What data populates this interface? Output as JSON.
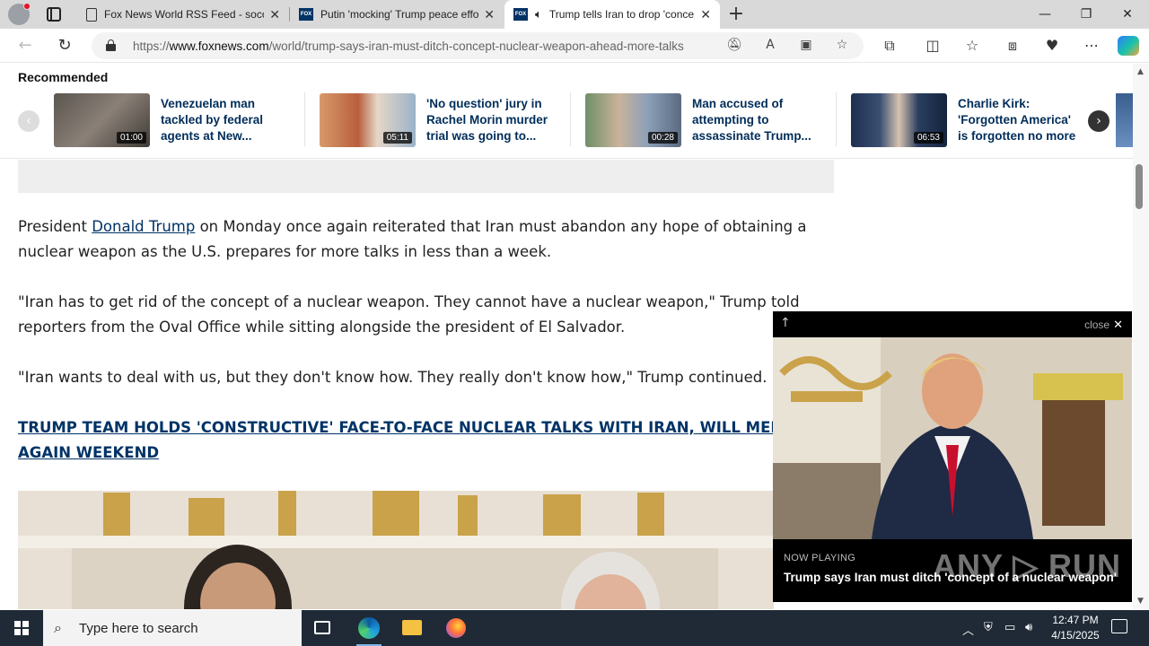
{
  "browser": {
    "tabs": [
      {
        "label": "Fox News World RSS Feed - soccer",
        "icon": "document-icon",
        "active": false
      },
      {
        "label": "Putin 'mocking' Trump peace effort",
        "icon": "foxnews-icon",
        "active": false
      },
      {
        "label": "Trump tells Iran to drop 'concept'",
        "icon": "foxnews-icon",
        "active": true,
        "audio": true
      }
    ],
    "url_prefix": "https://",
    "url_host": "www.foxnews.com",
    "url_path": "/world/trump-says-iran-must-ditch-concept-nuclear-weapon-ahead-more-talks"
  },
  "recommended": {
    "title": "Recommended",
    "items": [
      {
        "title": "Venezuelan man tackled by federal agents at New...",
        "duration": "01:00"
      },
      {
        "title": "'No question' jury in Rachel Morin murder trial was going to...",
        "duration": "05:11"
      },
      {
        "title": "Man accused of attempting to assassinate Trump...",
        "duration": "00:28"
      },
      {
        "title": "Charlie Kirk: 'Forgotten America' is forgotten no more",
        "duration": "06:53"
      }
    ]
  },
  "article": {
    "p1_before": "President ",
    "p1_link": "Donald Trump",
    "p1_after": " on Monday once again reiterated that Iran must abandon any hope of obtaining a nuclear weapon as the U.S. prepares for more talks in less than a week.",
    "p2": "\"Iran has to get rid of the concept of a nuclear weapon. They cannot have a nuclear weapon,\" Trump told reporters from the Oval Office while sitting alongside the president of El Salvador.",
    "p3": "\"Iran wants to deal with us, but they don't know how. They really don't know how,\" Trump continued.",
    "headline_link": "TRUMP TEAM HOLDS 'CONSTRUCTIVE' FACE-TO-FACE NUCLEAR TALKS WITH IRAN, WILL MEET AGAIN WEEKEND"
  },
  "player": {
    "close_label": "close",
    "now_playing_label": "NOW PLAYING",
    "now_playing_title": "Trump says Iran must ditch 'concept of a nuclear weapon'",
    "watermark": "ANY ▷ RUN"
  },
  "taskbar": {
    "search_placeholder": "Type here to search",
    "time": "12:47 PM",
    "date": "4/15/2025"
  },
  "colors": {
    "link": "#003366",
    "taskbar": "#1f2a36",
    "tabstrip": "#d9d9d9"
  }
}
